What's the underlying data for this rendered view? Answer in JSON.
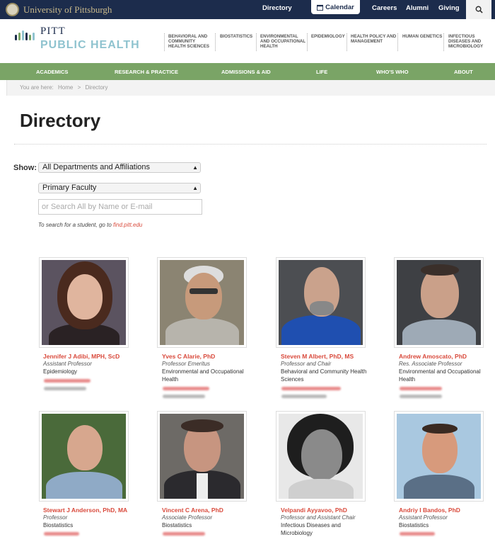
{
  "topbar": {
    "brand": "University of Pittsburgh",
    "links": [
      "Directory",
      "Calendar",
      "Careers",
      "Alumni",
      "Giving"
    ]
  },
  "header": {
    "pitt": "PITT",
    "public_health": "PUBLIC HEALTH",
    "departments": [
      "BEHAVIORAL AND\nCOMMUNITY\nHEALTH SCIENCES",
      "BIOSTATISTICS",
      "ENVIRONMENTAL\nAND OCCUPATIONAL\nHEALTH",
      "EPIDEMIOLOGY",
      "HEALTH POLICY AND\nMANAGEMENT",
      "HUMAN GENETICS",
      "INFECTIOUS\nDISEASES AND\nMICROBIOLOGY"
    ]
  },
  "nav": [
    "ACADEMICS",
    "RESEARCH & PRACTICE",
    "ADMISSIONS & AID",
    "LIFE",
    "WHO'S WHO",
    "ABOUT"
  ],
  "breadcrumb": {
    "prefix": "You are here:",
    "home": "Home",
    "sep": ">",
    "current": "Directory"
  },
  "page_title": "Directory",
  "filters": {
    "show_label": "Show:",
    "affiliation": "All Departments and Affiliations",
    "faculty_type": "Primary Faculty",
    "search_placeholder": "or Search All by Name or E-mail",
    "student_note": "To search for a student, go to",
    "student_link": "find.pitt.edu"
  },
  "people": [
    {
      "name": "Jennifer J Adibi, MPH, ScD",
      "role": "Assistant Professor",
      "dept": "Epidemiology"
    },
    {
      "name": "Yves C Alarie, PhD",
      "role": "Professor Emeritus",
      "dept": "Environmental and Occupational Health"
    },
    {
      "name": "Steven M Albert, PhD, MS",
      "role": "Professor and Chair",
      "dept": "Behavioral and Community Health Sciences"
    },
    {
      "name": "Andrew Amoscato, PhD",
      "role": "Res. Associate Professor",
      "dept": "Environmental and Occupational Health"
    },
    {
      "name": "Stewart J Anderson, PhD, MA",
      "role": "Professor",
      "dept": "Biostatistics"
    },
    {
      "name": "Vincent C Arena, PhD",
      "role": "Associate Professor",
      "dept": "Biostatistics"
    },
    {
      "name": "Velpandi Ayyavoo, PhD",
      "role": "Professor and Assistant Chair",
      "dept": "Infectious Diseases and Microbiology"
    },
    {
      "name": "Andriy I Bandos, PhD",
      "role": "Assistant Professor",
      "dept": "Biostatistics"
    }
  ],
  "icons": {
    "calendar": "calendar-icon",
    "search": "search-icon",
    "seal": "university-seal-icon"
  },
  "colors": {
    "topbar": "#1c2c4c",
    "nav": "#7aa466",
    "accent": "#d94a3c",
    "logo_teal": "#8fc3cf"
  }
}
